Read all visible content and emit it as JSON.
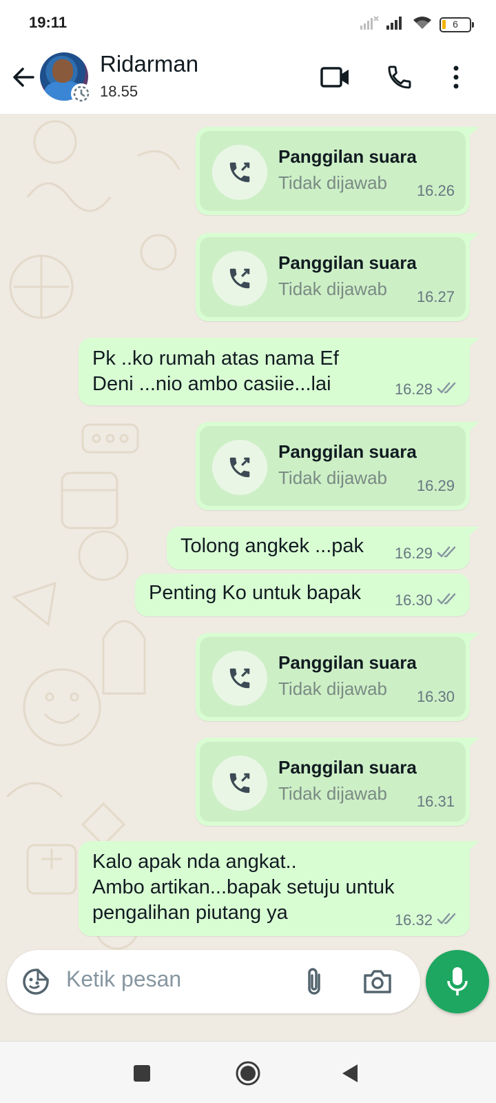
{
  "status_bar": {
    "time": "19:11",
    "battery_level": "6",
    "icons": [
      "signal-off-icon",
      "signal-icon",
      "wifi-icon",
      "battery-icon"
    ]
  },
  "header": {
    "contact_name": "Ridarman",
    "subtitle": "18.55",
    "icons": [
      "back-arrow-icon",
      "video-call-icon",
      "voice-call-icon",
      "more-options-icon"
    ]
  },
  "messages": [
    {
      "type": "call",
      "title": "Panggilan suara",
      "status": "Tidak dijawab",
      "time": "16.26"
    },
    {
      "type": "call",
      "title": "Panggilan suara",
      "status": "Tidak dijawab",
      "time": "16.27"
    },
    {
      "type": "text",
      "text": "Pk ..ko rumah atas nama Ef\nDeni ...nio ambo casiie...lai",
      "time": "16.28",
      "read": true
    },
    {
      "type": "call",
      "title": "Panggilan suara",
      "status": "Tidak dijawab",
      "time": "16.29"
    },
    {
      "type": "text",
      "text": "Tolong angkek ...pak",
      "time": "16.29",
      "read": true
    },
    {
      "type": "text",
      "text": "Penting Ko untuk bapak",
      "time": "16.30",
      "read": true
    },
    {
      "type": "call",
      "title": "Panggilan suara",
      "status": "Tidak dijawab",
      "time": "16.30"
    },
    {
      "type": "call",
      "title": "Panggilan suara",
      "status": "Tidak dijawab",
      "time": "16.31"
    },
    {
      "type": "text",
      "text": "Kalo apak nda angkat..\nAmbo artikan...bapak setuju untuk\npengalihan piutang ya",
      "time": "16.32",
      "read": true
    }
  ],
  "composer": {
    "placeholder": "Ketik pesan",
    "icons": [
      "sticker-icon",
      "attach-icon",
      "camera-icon",
      "mic-icon"
    ]
  },
  "navbar": {
    "icons": [
      "recent-apps-icon",
      "home-icon",
      "back-icon"
    ]
  },
  "colors": {
    "outgoing_bubble": "#d9fdd3",
    "chat_background": "#efeae2",
    "accent_green": "#1da760",
    "read_ticks": "#8696a0"
  }
}
